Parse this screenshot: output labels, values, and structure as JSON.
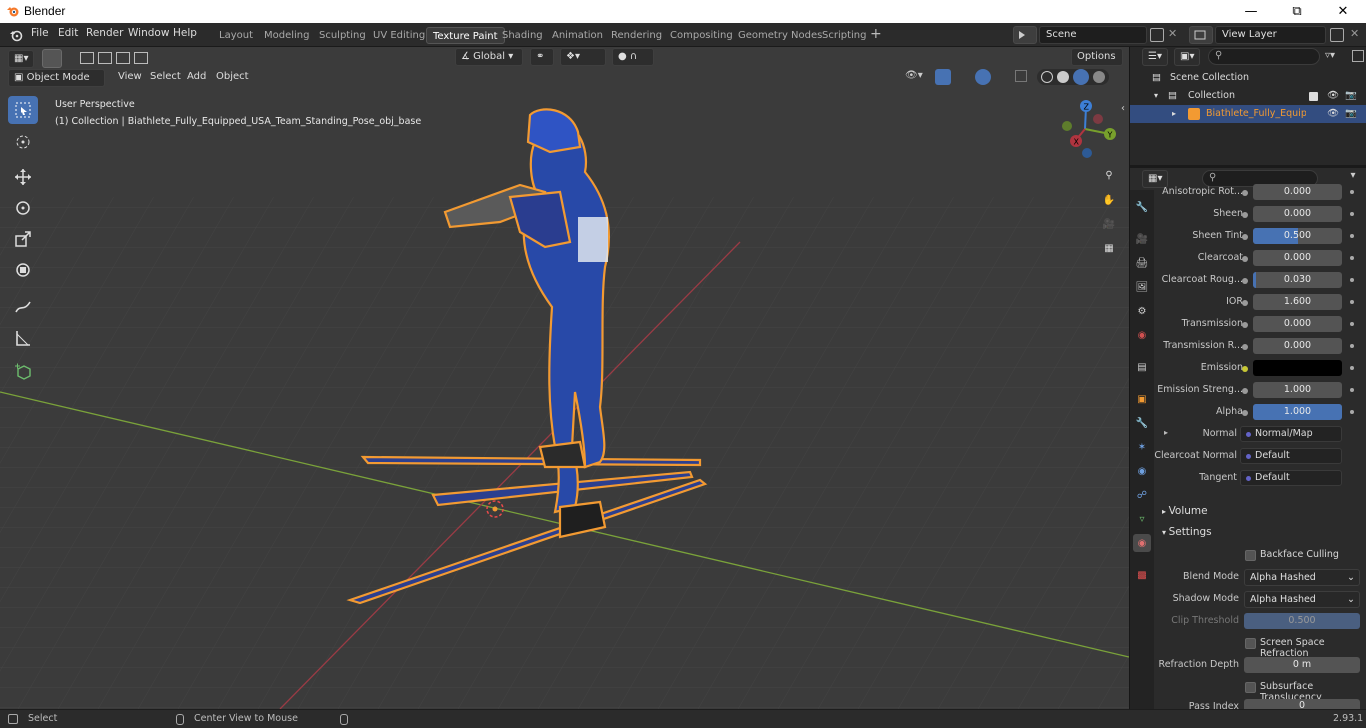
{
  "window": {
    "title": "Blender"
  },
  "menu": [
    "File",
    "Edit",
    "Render",
    "Window",
    "Help"
  ],
  "workspaces": [
    "Layout",
    "Modeling",
    "Sculpting",
    "UV Editing",
    "Texture Paint",
    "Shading",
    "Animation",
    "Rendering",
    "Compositing",
    "Geometry Nodes",
    "Scripting"
  ],
  "active_workspace": "Texture Paint",
  "scene": {
    "name": "Scene",
    "view_layer": "View Layer"
  },
  "toolbar": {
    "orientation": "Global",
    "options": "Options"
  },
  "viewport_header": {
    "mode": "Object Mode",
    "menus": [
      "View",
      "Select",
      "Add",
      "Object"
    ]
  },
  "viewport": {
    "perspective": "User Perspective",
    "info": "(1) Collection | Biathlete_Fully_Equipped_USA_Team_Standing_Pose_obj_base"
  },
  "gizmo": {
    "z": "Z",
    "y": "Y",
    "x": "X"
  },
  "outliner": {
    "scene_collection": "Scene Collection",
    "collection": "Collection",
    "object": "Biathlete_Fully_Equipped_USA_Team_Standing_Pose_obj_base"
  },
  "properties": [
    {
      "label": "Anisotropic Rot...",
      "value": "0.000",
      "kind": "num"
    },
    {
      "label": "Sheen",
      "value": "0.000",
      "kind": "num"
    },
    {
      "label": "Sheen Tint",
      "value": "0.500",
      "kind": "num",
      "fill": 0.5
    },
    {
      "label": "Clearcoat",
      "value": "0.000",
      "kind": "num"
    },
    {
      "label": "Clearcoat Roug...",
      "value": "0.030",
      "kind": "num",
      "fill": 0.03
    },
    {
      "label": "IOR",
      "value": "1.600",
      "kind": "num"
    },
    {
      "label": "Transmission",
      "value": "0.000",
      "kind": "num"
    },
    {
      "label": "Transmission R...",
      "value": "0.000",
      "kind": "num"
    },
    {
      "label": "Emission",
      "value": "",
      "kind": "color",
      "color": "#000000"
    },
    {
      "label": "Emission Streng...",
      "value": "1.000",
      "kind": "num"
    },
    {
      "label": "Alpha",
      "value": "1.000",
      "kind": "num",
      "fill": 1.0
    },
    {
      "label": "Normal",
      "value": "Normal/Map",
      "kind": "socket"
    },
    {
      "label": "Clearcoat Normal",
      "value": "Default",
      "kind": "socket"
    },
    {
      "label": "Tangent",
      "value": "Default",
      "kind": "socket"
    }
  ],
  "sections": {
    "volume": "Volume",
    "settings": "Settings"
  },
  "settings": {
    "backface_culling": "Backface Culling",
    "blend_mode_label": "Blend Mode",
    "blend_mode": "Alpha Hashed",
    "shadow_mode_label": "Shadow Mode",
    "shadow_mode": "Alpha Hashed",
    "clip_threshold_label": "Clip Threshold",
    "clip_threshold": "0.500",
    "ssr": "Screen Space Refraction",
    "refraction_depth_label": "Refraction Depth",
    "refraction_depth": "0 m",
    "subsurface": "Subsurface Translucency",
    "pass_index_label": "Pass Index",
    "pass_index": "0"
  },
  "statusbar": {
    "select": "Select",
    "center": "Center View to Mouse",
    "version": "2.93.1"
  },
  "colors": {
    "accent": "#4772b3",
    "selection_outline": "#f29a32",
    "x_axis": "#b0343f",
    "y_axis": "#78a02c",
    "z_axis": "#3d7fd6"
  }
}
